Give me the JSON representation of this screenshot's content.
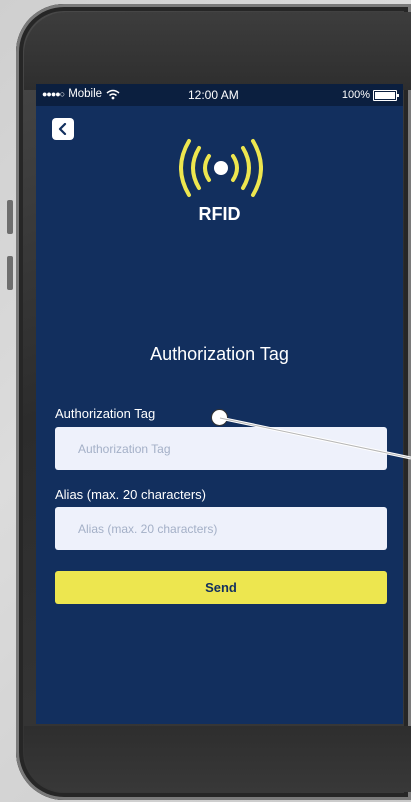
{
  "status_bar": {
    "carrier": "Mobile",
    "time": "12:00 AM",
    "battery": "100%"
  },
  "header": {
    "back_icon": "chevron-left-icon",
    "logo_icon": "rfid-signal-icon",
    "logo_text": "RFID"
  },
  "main": {
    "title": "Authorization Tag",
    "fields": [
      {
        "label": "Authorization Tag",
        "placeholder": "Authorization Tag",
        "value": ""
      },
      {
        "label": "Alias (max. 20 characters)",
        "placeholder": "Alias (max. 20 characters)",
        "value": ""
      }
    ],
    "send_label": "Send"
  },
  "colors": {
    "screen_bg": "#122f5e",
    "accent_yellow": "#ede64f",
    "input_bg": "#eef1fb"
  }
}
